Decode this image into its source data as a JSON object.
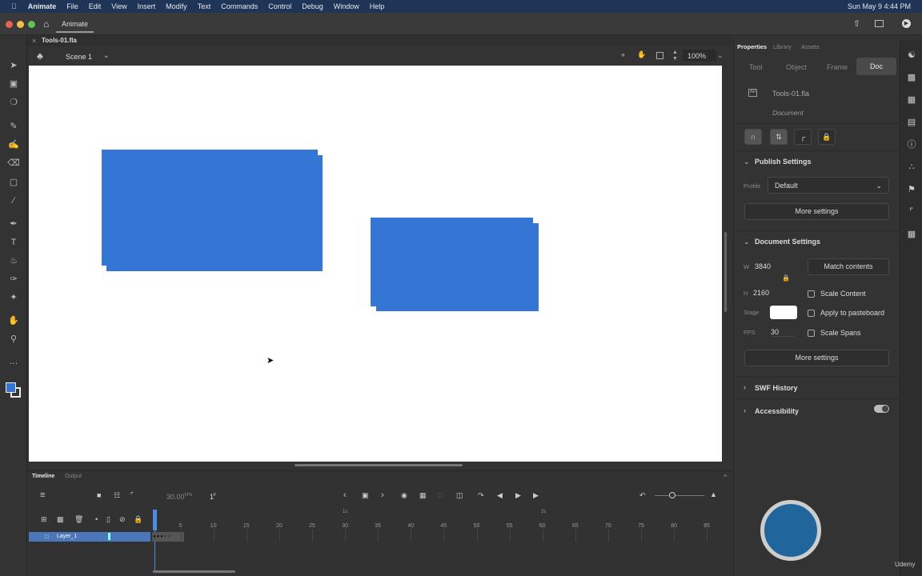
{
  "menubar": {
    "app": "Animate",
    "items": [
      "File",
      "Edit",
      "View",
      "Insert",
      "Modify",
      "Text",
      "Commands",
      "Control",
      "Debug",
      "Window",
      "Help"
    ],
    "clock": "Sun May 9  4:44 PM"
  },
  "titlebar": {
    "home_tab": "Animate"
  },
  "document": {
    "tab": "Tools-01.fla",
    "scene": "Scene 1",
    "zoom": "100%"
  },
  "stage": {
    "background": "#ffffff",
    "shape_color": "#3476d4"
  },
  "properties": {
    "tabs": [
      "Properties",
      "Library",
      "Assets"
    ],
    "subtabs": [
      "Tool",
      "Object",
      "Frame",
      "Doc"
    ],
    "active_subtab": "Doc",
    "file_name": "Tools-01.fla",
    "file_type": "Document",
    "publish": {
      "title": "Publish Settings",
      "profile_label": "Profile",
      "profile_value": "Default",
      "more": "More settings"
    },
    "docsettings": {
      "title": "Document Settings",
      "w_label": "W",
      "w": "3840",
      "h_label": "H",
      "h": "2160",
      "match": "Match contents",
      "stage_label": "Stage",
      "fps_label": "FPS",
      "fps": "30",
      "scale_content": "Scale Content",
      "apply_pasteboard": "Apply to pasteboard",
      "scale_spans": "Scale Spans",
      "more": "More settings"
    },
    "swf_history": "SWF History",
    "accessibility": "Accessibility"
  },
  "timeline": {
    "tabs": [
      "Timeline",
      "Output"
    ],
    "fps": "30.00",
    "fps_unit": "FPS",
    "frame": "1",
    "frame_unit": "F",
    "layer": "Layer_1",
    "seconds": [
      "1s",
      "2s"
    ],
    "ticks": [
      "5",
      "10",
      "15",
      "20",
      "25",
      "30",
      "35",
      "40",
      "45",
      "50",
      "55",
      "60",
      "65",
      "70",
      "75",
      "80",
      "85"
    ]
  },
  "watermark": "Udemy"
}
